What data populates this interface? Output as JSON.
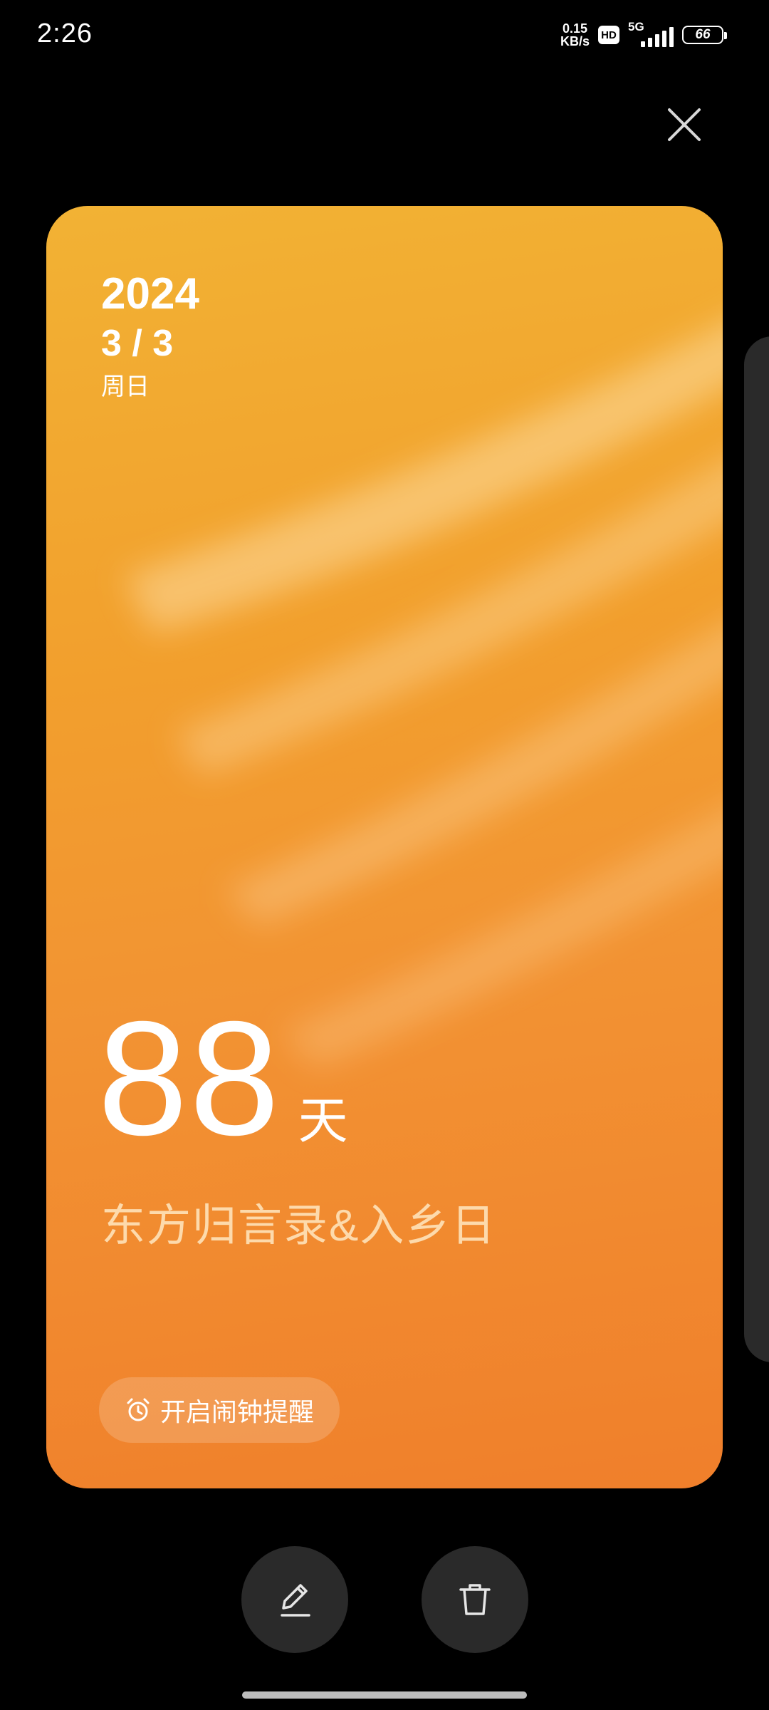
{
  "status_bar": {
    "time": "2:26",
    "net_speed_value": "0.15",
    "net_speed_unit": "KB/s",
    "hd_label": "HD",
    "network_type": "5G",
    "battery_level": "66"
  },
  "card": {
    "year": "2024",
    "month_day": "3 / 3",
    "weekday": "周日",
    "days_count": "88",
    "days_unit": "天",
    "event_title": "东方归言录&入乡日",
    "alarm_button_label": "开启闹钟提醒",
    "gradient_colors": [
      "#f2b234",
      "#f29f2d",
      "#f29333",
      "#f07f2b"
    ]
  },
  "actions": {
    "edit_icon": "pencil-icon",
    "delete_icon": "trash-icon"
  },
  "colors": {
    "background": "#000000",
    "button_bg": "#2a2a2a"
  }
}
